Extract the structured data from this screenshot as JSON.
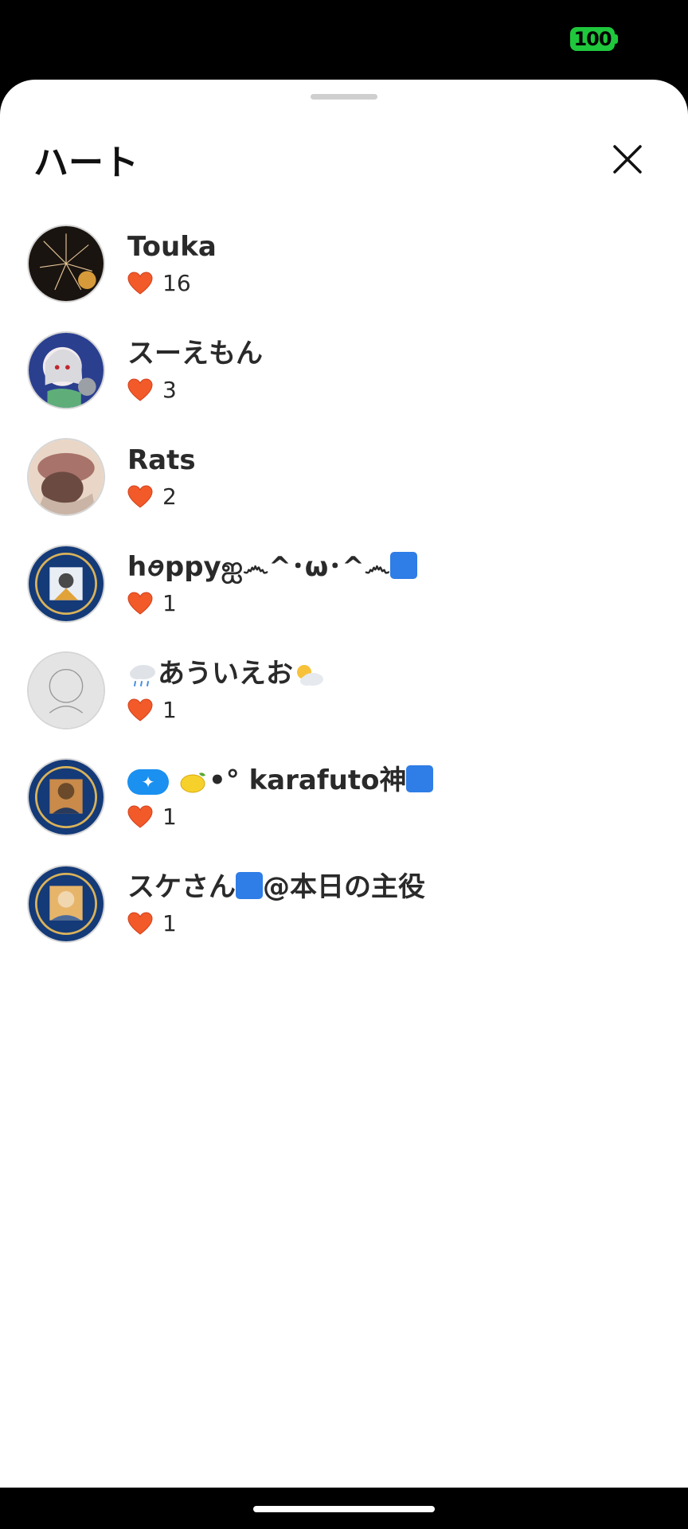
{
  "status": {
    "battery": "100"
  },
  "sheet": {
    "title": "ハート",
    "close_icon": "close-icon"
  },
  "users": [
    {
      "name": "Touka",
      "count": "16"
    },
    {
      "name": "スーえもん",
      "count": "3"
    },
    {
      "name": "Rats",
      "count": "2"
    },
    {
      "name": "hꪮppyஐ෴^･ω･^෴",
      "count": "1"
    },
    {
      "name": "あういえお",
      "count": "1"
    },
    {
      "name": "•° karafuto神",
      "count": "1"
    },
    {
      "name": "スケさん",
      "name_suffix": "@本日の主役",
      "count": "1"
    }
  ],
  "colors": {
    "heart": "#f25a2a",
    "accent_blue": "#2f7de6",
    "battery": "#1fc73c"
  }
}
